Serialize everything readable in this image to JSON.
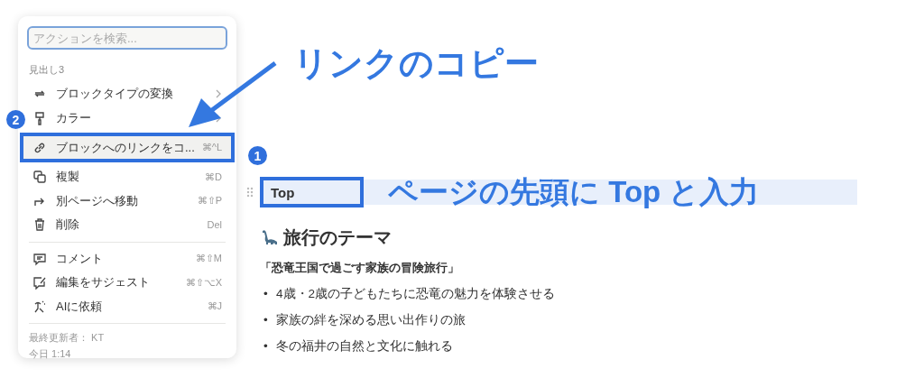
{
  "menu": {
    "search": {
      "placeholder": "アクションを検索..."
    },
    "section_label": "見出し3",
    "groups": [
      {
        "items": [
          {
            "kind": "convert",
            "label": "ブロックタイプの変換",
            "submenu": true,
            "selected": false
          },
          {
            "kind": "color",
            "label": "カラー",
            "submenu": true,
            "selected": false
          },
          {
            "kind": "link",
            "label": "ブロックへのリンクをコ...",
            "shortcut": "⌘^L",
            "submenu": false,
            "selected": true
          },
          {
            "kind": "duplicate",
            "label": "複製",
            "shortcut": "⌘D",
            "submenu": false,
            "selected": false
          },
          {
            "kind": "move",
            "label": "別ページへ移動",
            "shortcut": "⌘⇧P",
            "submenu": false,
            "selected": false
          },
          {
            "kind": "delete",
            "label": "削除",
            "shortcut": "Del",
            "submenu": false,
            "selected": false
          }
        ]
      },
      {
        "items": [
          {
            "kind": "comment",
            "label": "コメント",
            "shortcut": "⌘⇧M",
            "submenu": false,
            "selected": false
          },
          {
            "kind": "suggest",
            "label": "編集をサジェスト",
            "shortcut": "⌘⇧⌥X",
            "submenu": false,
            "selected": false
          },
          {
            "kind": "ai",
            "label": "AIに依頼",
            "shortcut": "⌘J",
            "submenu": false,
            "selected": false
          }
        ]
      }
    ],
    "footer": [
      "最終更新者： KT",
      "今日 1:14"
    ]
  },
  "page": {
    "top_block": {
      "text": "Top",
      "selected": true,
      "callout": "ページの先頭に Top と入力"
    },
    "heading": "旅行のテーマ",
    "subtitle": "「恐竜王国で過ごす家族の冒険旅行」",
    "bullets": [
      {
        "marker": "•",
        "text": "4歳・2歳の子どもたちに恐竜の魅力を体験させる"
      },
      {
        "marker": "•",
        "text": "家族の絆を深める思い出作りの旅"
      },
      {
        "marker": "•",
        "text": "冬の福井の自然と文化に触れる"
      }
    ]
  },
  "annotations": [
    {
      "kind": "callout",
      "text": "リンクのコピー"
    },
    {
      "kind": "badge",
      "text": "2"
    },
    {
      "kind": "badge",
      "text": "1"
    }
  ]
}
